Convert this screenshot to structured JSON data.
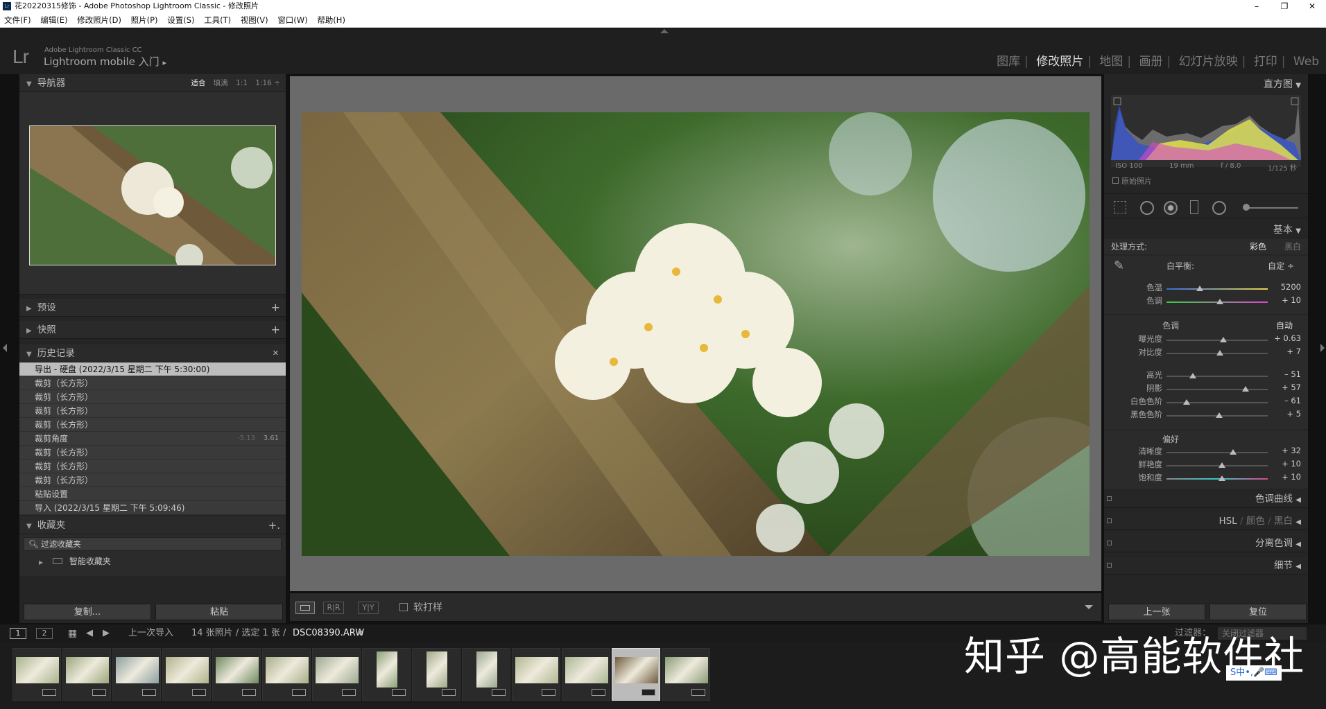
{
  "window": {
    "title": "花20220315修饰 - Adobe Photoshop Lightroom Classic - 修改照片",
    "app_icon": "Lr",
    "minimize": "–",
    "restore": "❐",
    "close": "✕"
  },
  "menu": [
    "文件(F)",
    "编辑(E)",
    "修改照片(D)",
    "照片(P)",
    "设置(S)",
    "工具(T)",
    "视图(V)",
    "窗口(W)",
    "帮助(H)"
  ],
  "identity": {
    "logo": "Lr",
    "brand_small": "Adobe Lightroom Classic CC",
    "brand_main": "Lightroom mobile 入门",
    "arrow": "▸"
  },
  "modules": [
    "图库",
    "修改照片",
    "地图",
    "画册",
    "幻灯片放映",
    "打印",
    "Web"
  ],
  "navigator": {
    "title": "导航器",
    "zoom": [
      "适合",
      "填满",
      "1:1",
      "1:16"
    ]
  },
  "presets": {
    "title": "预设",
    "plus": "+"
  },
  "snapshots": {
    "title": "快照",
    "plus": "+"
  },
  "history": {
    "title": "历史记录",
    "close": "✕",
    "items": [
      {
        "label": "导出 - 硬盘 (2022/3/15 星期二 下午 5:30:00)",
        "selected": true
      },
      {
        "label": "裁剪（长方形）"
      },
      {
        "label": "裁剪（长方形）"
      },
      {
        "label": "裁剪（长方形）"
      },
      {
        "label": "裁剪（长方形）"
      },
      {
        "label": "裁剪角度",
        "n1": "-5.13",
        "n2": "3.61"
      },
      {
        "label": "裁剪（长方形）"
      },
      {
        "label": "裁剪（长方形）"
      },
      {
        "label": "裁剪（长方形）"
      },
      {
        "label": "粘贴设置"
      },
      {
        "label": "导入 (2022/3/15 星期二 下午 5:09:46)"
      }
    ]
  },
  "collections": {
    "title": "收藏夹",
    "plus": "+.",
    "filter": "过滤收藏夹",
    "smart": "智能收藏夹"
  },
  "left_buttons": {
    "copy": "复制...",
    "paste": "粘贴"
  },
  "toolbar": {
    "softproof": "软打样",
    "rr": "R|R",
    "yy": "Y|Y"
  },
  "histogram": {
    "title": "直方图",
    "iso": "ISO 100",
    "focal": "19 mm",
    "aperture": "f / 8.0",
    "shutter": "1/125 秒",
    "original": "原始照片"
  },
  "basic": {
    "title": "基本",
    "treatment_label": "处理方式:",
    "color": "彩色",
    "bw": "黑白",
    "wb_label": "白平衡:",
    "wb_value": "自定 ÷",
    "tone_title": "色调",
    "auto": "自动",
    "presence_title": "偏好"
  },
  "sliders_wb": [
    {
      "label": "色温",
      "value": "5200",
      "pos": 0.33
    },
    {
      "label": "色调",
      "value": "+ 10",
      "pos": 0.53
    }
  ],
  "sliders_tone1": [
    {
      "label": "曝光度",
      "value": "+ 0.63",
      "pos": 0.56
    },
    {
      "label": "对比度",
      "value": "+ 7",
      "pos": 0.53
    }
  ],
  "sliders_tone2": [
    {
      "label": "高光",
      "value": "– 51",
      "pos": 0.26
    },
    {
      "label": "阴影",
      "value": "+ 57",
      "pos": 0.78
    },
    {
      "label": "白色色阶",
      "value": "– 61",
      "pos": 0.2
    },
    {
      "label": "黑色色阶",
      "value": "+ 5",
      "pos": 0.52
    }
  ],
  "sliders_presence": [
    {
      "label": "清晰度",
      "value": "+ 32",
      "pos": 0.66
    },
    {
      "label": "鲜艳度",
      "value": "+ 10",
      "pos": 0.55
    },
    {
      "label": "饱和度",
      "value": "+ 10",
      "pos": 0.55
    }
  ],
  "right_sections": {
    "tone_curve": "色调曲线",
    "hsl": "HSL",
    "hsl_color": "颜色",
    "hsl_bw": "黑白",
    "split": "分离色调",
    "detail": "细节"
  },
  "right_buttons": {
    "prev": "上一张",
    "reset": "复位"
  },
  "filmbar": {
    "page1": "1",
    "page2": "2",
    "source": "上一次导入",
    "count": "14 张照片 / 选定 1 张 /",
    "file": "DSC08390.ARW",
    "filter_label": "过滤器：",
    "filter_value": "关闭过滤器"
  },
  "watermark": "知乎 @高能软件社",
  "ime": "S中•,🎤⌨"
}
